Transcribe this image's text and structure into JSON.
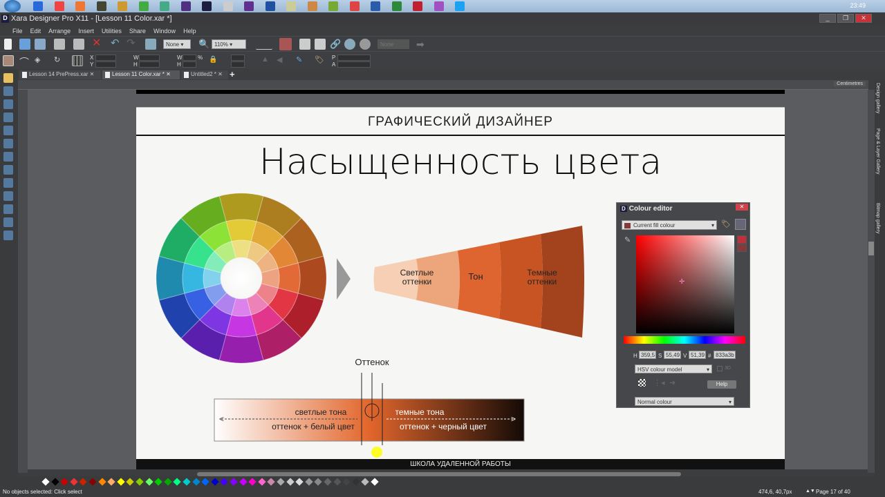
{
  "taskbar": {
    "clock": "23:49"
  },
  "window": {
    "title": "Xara Designer Pro X11 - [Lesson 11 Color.xar *]",
    "logo": "D"
  },
  "menu": [
    "File",
    "Edit",
    "Arrange",
    "Insert",
    "Utilities",
    "Share",
    "Window",
    "Help"
  ],
  "toolbar": {
    "fill_select": "None",
    "zoom_value": "110%",
    "name_field": "None"
  },
  "infobar": {
    "x_label": "X",
    "y_label": "Y",
    "w_label": "W",
    "h_label": "H",
    "w2_label": "W",
    "h2_label": "H",
    "pct": "%",
    "p_label": "P",
    "a_label": "A"
  },
  "tabs": [
    {
      "label": "Lesson 14 PrePress.xar",
      "active": false
    },
    {
      "label": "Lesson 11 Color.xar *",
      "active": true
    },
    {
      "label": "Untitled2 *",
      "active": false
    }
  ],
  "ruler": {
    "units": "Centimetres"
  },
  "slide": {
    "header": "ГРАФИЧЕСКИЙ ДИЗАЙНЕР",
    "title": "Насыщенность цвета",
    "fan": {
      "light": "Светлые оттенки",
      "tone": "Тон",
      "dark": "Темные оттенки"
    },
    "hue_label": "Оттенок",
    "bar": {
      "left_line1": "светлые тона",
      "left_line2": "оттенок + белый цвет",
      "right_line1": "темные тона",
      "right_line2": "оттенок + черный цвет"
    },
    "footer": "ШКОЛА УДАЛЕННОЙ РАБОТЫ"
  },
  "colour_editor": {
    "title": "Colour editor",
    "fill_select": "Current fill colour",
    "h_label": "H",
    "h": "359,5",
    "s_label": "S",
    "s": "55,49",
    "v_label": "V",
    "v": "51,39",
    "hex_label": "#",
    "hex": "833a3b",
    "model": "HSV colour model",
    "three_d": "3D",
    "help": "Help",
    "type": "Normal colour",
    "current_color": "#833a3b"
  },
  "gallery_tabs": [
    "Design gallery",
    "Page & Layer Gallery",
    "Bitmap gallery"
  ],
  "status": {
    "message": "No objects selected: Click select",
    "coords": "474,6, 40,7px",
    "page": "Page 17 of 40"
  }
}
